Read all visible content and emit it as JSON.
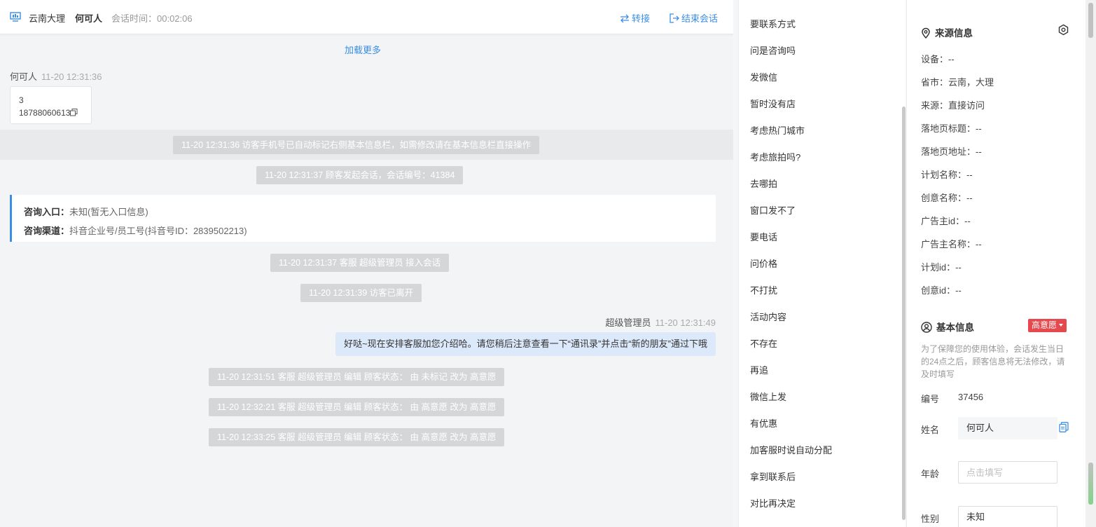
{
  "header": {
    "city": "云南大理",
    "visitor_name": "何可人",
    "session_time": "会话时间：00:02:06",
    "transfer_label": "转接",
    "end_label": "结束会话"
  },
  "chat": {
    "load_more": "加载更多",
    "visitor_sender": "何可人",
    "visitor_time": "11-20 12:31:36",
    "visitor_message_line1": "3",
    "visitor_message_line2": "18788060613",
    "sys1": "11-20 12:31:36 访客手机号已自动标记右侧基本信息栏，如需修改请在基本信息栏直接操作",
    "sys2": "11-20 12:31:37 顾客发起会话，会话编号：41384",
    "entry_label": "咨询入口：",
    "entry_value": "未知(暂无入口信息)",
    "channel_label": "咨询渠道：",
    "channel_value": "抖音企业号/员工号(抖音号ID：2839502213)",
    "sys3": "11-20 12:31:37 客服 超级管理员 接入会话",
    "sys4": "11-20 12:31:39 访客已离开",
    "agent_name": "超级管理员",
    "agent_time": "11-20 12:31:49",
    "agent_message": "好哒~现在安排客服加您介绍哈。请您稍后注意查看一下“通讯录”并点击“新的朋友”通过下哦",
    "sys5": "11-20 12:31:51 客服 超级管理员 编辑 顾客状态： 由 未标记 改为 高意愿",
    "sys6": "11-20 12:32:21 客服 超级管理员 编辑 顾客状态： 由 高意愿 改为 高意愿",
    "sys7": "11-20 12:33:25 客服 超级管理员 编辑 顾客状态： 由 高意愿 改为 高意愿"
  },
  "quick_replies": [
    "要联系方式",
    "问是咨询吗",
    "发微信",
    "暂时没有店",
    "考虑热门城市",
    "考虑旅拍吗?",
    "去哪拍",
    "窗口发不了",
    "要电话",
    "问价格",
    "不打扰",
    "活动内容",
    "不存在",
    "再追",
    "微信上发",
    "有优惠",
    "加客服时说自动分配",
    "拿到联系后",
    "对比再决定"
  ],
  "source_info": {
    "title": "来源信息",
    "device": "设备：--",
    "region": "省市：云南，大理",
    "source": "来源：直接访问",
    "landing_title": "落地页标题：--",
    "landing_url": "落地页地址：--",
    "plan_name": "计划名称：--",
    "creative_name": "创意名称：--",
    "advertiser_id": "广告主id：--",
    "advertiser_name": "广告主名称：--",
    "plan_id": "计划id：--",
    "creative_id": "创意id：--"
  },
  "basic_info": {
    "title": "基本信息",
    "intent_badge": "高意愿",
    "note": "为了保障您的使用体验，会话发生当日的24点之后，顾客信息将无法修改，请及时填写",
    "id_label": "编号",
    "id_value": "37456",
    "name_label": "姓名",
    "name_value": "何可人",
    "age_label": "年龄",
    "age_placeholder": "点击填写",
    "gender_label": "性别",
    "gender_value": "未知"
  },
  "colors": {
    "accent": "#3a8ee6",
    "badge": "#e5484d",
    "agent_bubble": "#dce9fb",
    "system_pill": "#d5d6d8"
  }
}
